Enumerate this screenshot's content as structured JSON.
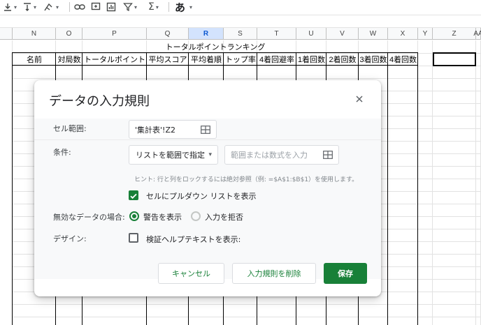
{
  "toolbar": {
    "font_button_label": "あ",
    "icons": [
      "borders-icon",
      "align-icon",
      "text-rotate-icon",
      "link-icon",
      "comment-icon",
      "chart-icon",
      "filter-icon",
      "functions-icon",
      "input-tools-icon"
    ]
  },
  "sheet": {
    "columns": [
      "N",
      "O",
      "P",
      "Q",
      "R",
      "S",
      "T",
      "U",
      "V",
      "W",
      "X",
      "Y",
      "Z",
      "AA"
    ],
    "selected_column": "R",
    "table_title": "トータルポイントランキング",
    "headers": [
      "名前",
      "対局数",
      "トータルポイント",
      "平均スコア",
      "平均着順",
      "トップ率",
      "4着回避率",
      "1着回数",
      "2着回数",
      "3着回数",
      "4着回数"
    ]
  },
  "dialog": {
    "title": "データの入力規則",
    "cell_range_label": "セル範囲:",
    "cell_range_value": "'集計表'!Z2",
    "criteria_label": "条件:",
    "criteria_type": "リストを範囲で指定",
    "range_placeholder": "範囲または数式を入力",
    "hint": "ヒント: 行と列をロックするには絶対参照（例: =$A$1:$B$1）を使用します。",
    "show_dropdown_label": "セルにプルダウン リストを表示",
    "show_dropdown_checked": true,
    "invalid_data_label": "無効なデータの場合:",
    "invalid_option_warn": "警告を表示",
    "invalid_option_reject": "入力を拒否",
    "invalid_selected": "warn",
    "appearance_label": "デザイン:",
    "help_text_label": "検証ヘルプテキストを表示:",
    "help_text_checked": false,
    "cancel_label": "キャンセル",
    "remove_label": "入力規則を削除",
    "save_label": "保存"
  },
  "colors": {
    "accent": "#188038",
    "selected_header_bg": "#d3e3fd"
  }
}
